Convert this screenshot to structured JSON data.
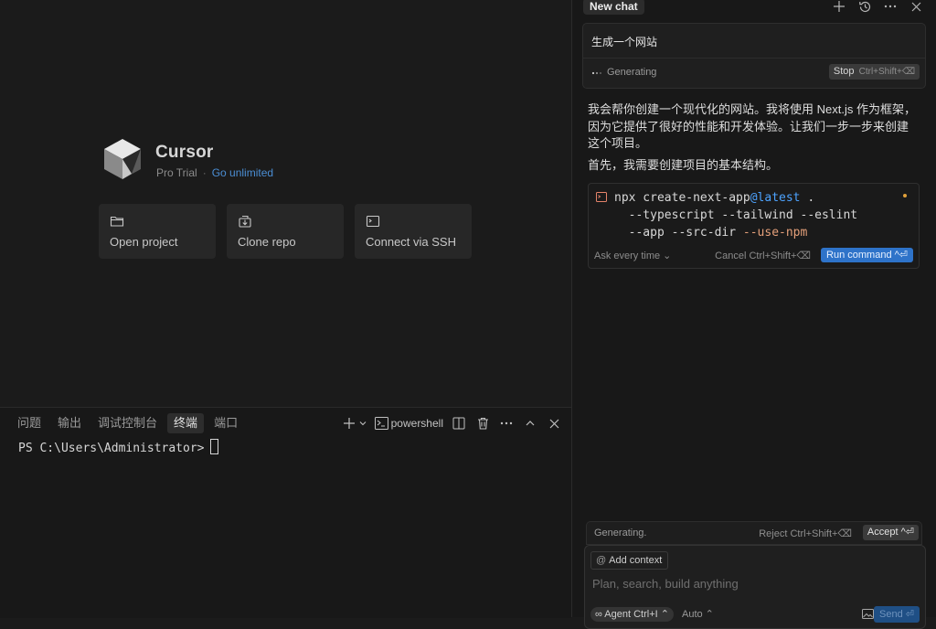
{
  "welcome": {
    "app_name": "Cursor",
    "plan": "Pro Trial",
    "separator": "·",
    "upgrade_link": "Go unlimited",
    "cards": [
      {
        "label": "Open project",
        "icon": "folder-icon"
      },
      {
        "label": "Clone repo",
        "icon": "clone-repo-icon"
      },
      {
        "label": "Connect via SSH",
        "icon": "terminal-window-icon"
      }
    ]
  },
  "panel": {
    "tabs": [
      "问题",
      "输出",
      "调试控制台",
      "终端",
      "端口"
    ],
    "active_tab": "终端",
    "shell_name": "powershell",
    "prompt": "PS C:\\Users\\Administrator>"
  },
  "chat": {
    "tab_title": "New chat",
    "user_message": "生成一个网站",
    "status": "Generating",
    "stop_label": "Stop",
    "stop_shortcut": "Ctrl+Shift+⌫",
    "assistant_paragraphs": [
      "我会帮你创建一个现代化的网站。我将使用 Next.js 作为框架，因为它提供了很好的性能和开发体验。让我们一步一步来创建这个项目。",
      "首先，我需要创建项目的基本结构。"
    ],
    "command": {
      "line1_a": "npx create-next-app",
      "line1_b": "@latest",
      "line1_c": " .",
      "line2": "--typescript --tailwind --eslint",
      "line3_a": "--app --src-dir ",
      "line3_b": "--use-npm",
      "ask_mode": "Ask every time ⌄",
      "cancel_label": "Cancel Ctrl+Shift+⌫",
      "run_label": "Run command ^⏎"
    },
    "gen_bar": {
      "label": "Generating.",
      "reject_label": "Reject Ctrl+Shift+⌫",
      "accept_label": "Accept ^⏎"
    },
    "input": {
      "add_context": "Add context",
      "placeholder": "Plan, search, build anything",
      "agent_label": "∞ Agent Ctrl+I ⌃",
      "model_label": "Auto ⌃",
      "send_label": "Send ⏎"
    }
  }
}
